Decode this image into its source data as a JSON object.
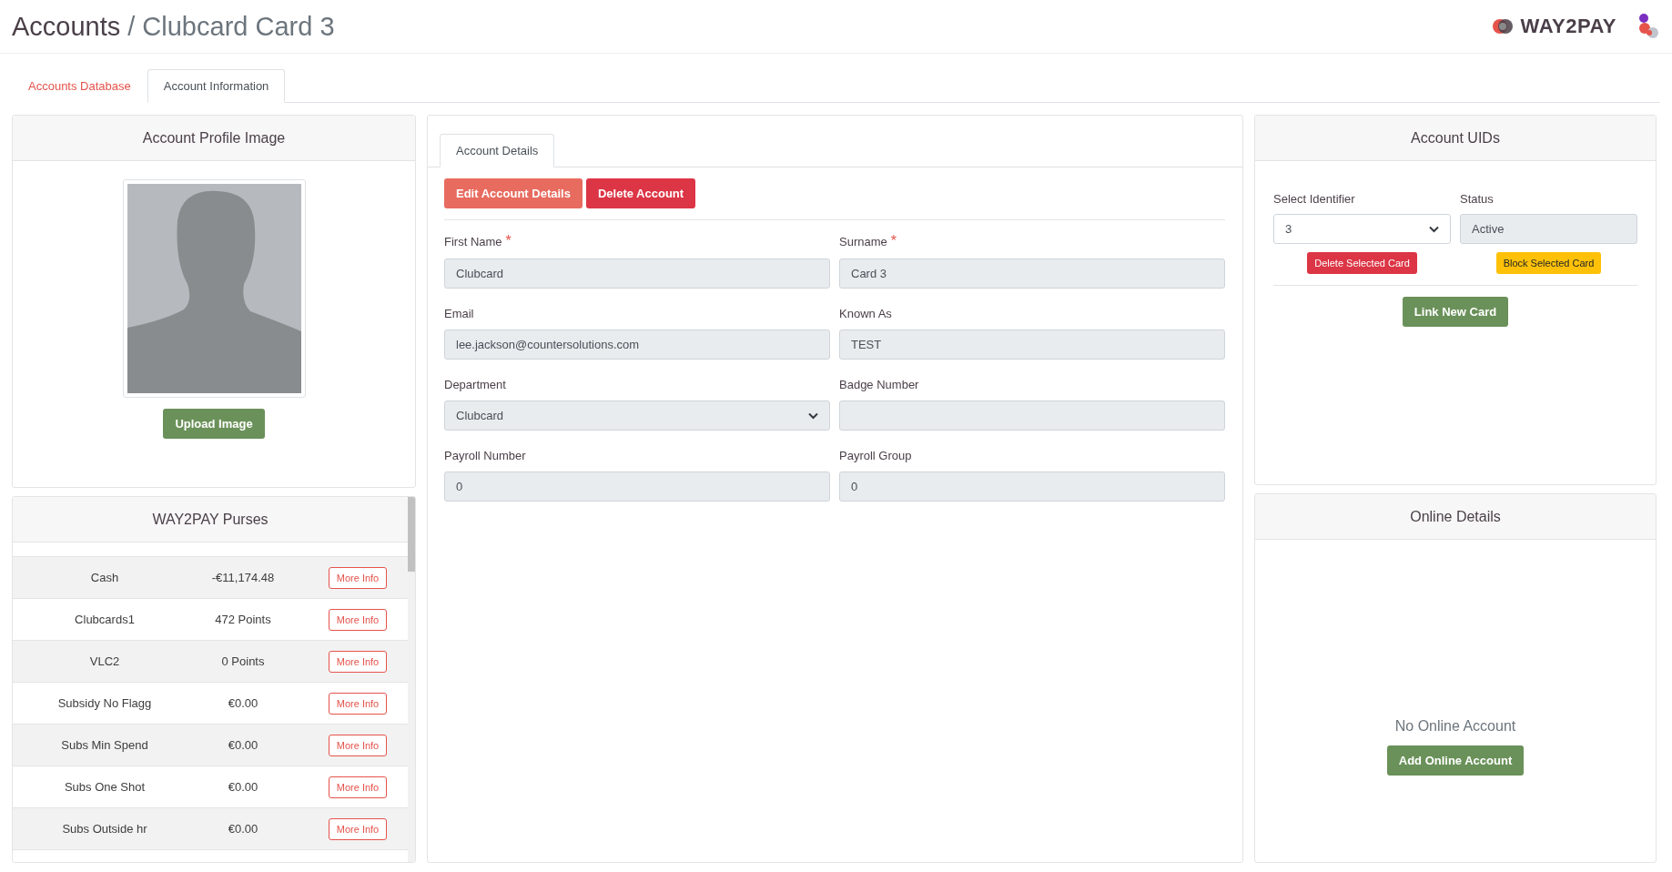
{
  "header": {
    "title": "Accounts",
    "separator": "/",
    "subtitle": "Clubcard Card 3",
    "logo_text": "WAY2PAY"
  },
  "tabs": [
    {
      "label": "Accounts Database",
      "selected": false
    },
    {
      "label": "Account Information",
      "selected": true
    }
  ],
  "profile": {
    "title": "Account Profile Image",
    "button": "Upload Image"
  },
  "purses": {
    "title": "WAY2PAY Purses",
    "rows": [
      {
        "name": "Cash",
        "balance": "-€11,174.48",
        "button": "More Info"
      },
      {
        "name": "Clubcards1",
        "balance": "472 Points",
        "button": "More Info"
      },
      {
        "name": "VLC2",
        "balance": "0 Points",
        "button": "More Info"
      },
      {
        "name": "Subsidy No Flagg",
        "balance": "€0.00",
        "button": "More Info"
      },
      {
        "name": "Subs Min Spend",
        "balance": "€0.00",
        "button": "More Info"
      },
      {
        "name": "Subs One Shot",
        "balance": "€0.00",
        "button": "More Info"
      },
      {
        "name": "Subs Outside hr",
        "balance": "€0.00",
        "button": "More Info"
      }
    ]
  },
  "details": {
    "tabs": [
      {
        "label": "Account Details",
        "selected": true
      }
    ],
    "buttons": [
      {
        "label": "Edit Account Details",
        "kind": "edit"
      },
      {
        "label": "Delete Account",
        "kind": "delete"
      }
    ],
    "fields": [
      {
        "label": "First Name",
        "mark": "*",
        "kind": "input",
        "value": "Clubcard"
      },
      {
        "label": "Surname",
        "mark": "*",
        "kind": "input",
        "value": "Card 3"
      },
      {
        "label": "Email",
        "kind": "input",
        "value": "lee.jackson@countersolutions.com"
      },
      {
        "label": "Known As",
        "kind": "input",
        "value": "TEST"
      },
      {
        "label": "Department",
        "kind": "select",
        "value": "Clubcard"
      },
      {
        "label": "Badge Number",
        "kind": "input"
      },
      {
        "label": "Payroll Number",
        "kind": "input",
        "value": "0"
      },
      {
        "label": "Payroll Group",
        "kind": "input",
        "value": "0"
      }
    ]
  },
  "uids": {
    "title": "Account UIDs",
    "identifier_label": "Select Identifier",
    "identifier": "3",
    "status_label": "Status",
    "status": "Active",
    "delete_button": "Delete Selected Card",
    "block_button": "Block Selected Card",
    "link_button": "Link New Card"
  },
  "online": {
    "title": "Online Details",
    "message": "No Online Account",
    "button": "Add Online Account"
  }
}
